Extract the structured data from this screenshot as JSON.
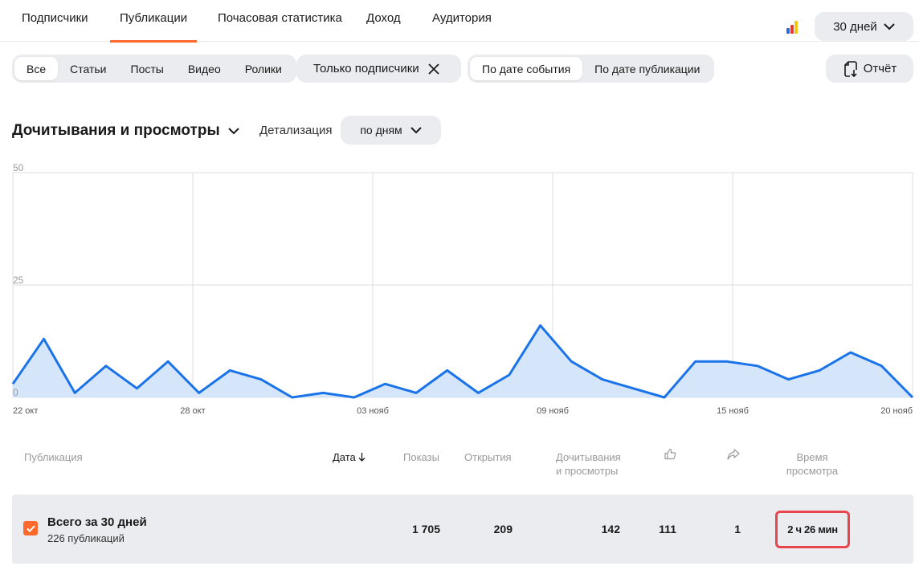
{
  "top_tabs": [
    {
      "label": "Подписчики",
      "active": false
    },
    {
      "label": "Публикации",
      "active": true
    },
    {
      "label": "Почасовая статистика",
      "active": false
    },
    {
      "label": "Доход",
      "active": false
    },
    {
      "label": "Аудитория",
      "active": false
    }
  ],
  "period": {
    "label": "30 дней",
    "icon": "chevron-down-icon"
  },
  "brand_colors": [
    "#2f6bd8",
    "#e63b2e",
    "#f5c518"
  ],
  "content_filter": {
    "items": [
      "Все",
      "Статьи",
      "Посты",
      "Видео",
      "Ролики"
    ],
    "selected": "Все"
  },
  "subscribers_filter": {
    "label": "Только подписчики",
    "icon": "close-icon"
  },
  "date_mode": {
    "items": [
      "По дате события",
      "По дате публикации"
    ],
    "selected": "По дате события"
  },
  "report_button": {
    "label": "Отчёт",
    "icon": "document-download-icon"
  },
  "chart_header": {
    "title": "Дочитывания и просмотры",
    "detail_label": "Детализация",
    "detail_value": "по дням"
  },
  "chart_data": {
    "type": "area",
    "ylim": [
      0,
      50
    ],
    "yticks": [
      "50",
      "25",
      "0"
    ],
    "xtick_labels": [
      "22 окт",
      "28 окт",
      "03 нояб",
      "09 нояб",
      "15 нояб",
      "20 нояб"
    ],
    "values": [
      3,
      13,
      1,
      7,
      2,
      8,
      1,
      6,
      4,
      0,
      1,
      0,
      3,
      1,
      6,
      1,
      5,
      16,
      8,
      4,
      2,
      0,
      8,
      8,
      7,
      4,
      6,
      10,
      7,
      0
    ],
    "line_color": "#1a73e8",
    "fill_color": "#d5e6fb",
    "grid": true
  },
  "table_header": {
    "publication": "Публикация",
    "date": "Дата",
    "shows": "Показы",
    "opens": "Открытия",
    "reads_line1": "Дочитывания",
    "reads_line2": "и просмотры",
    "likes_icon": "thumbs-up-icon",
    "shares_icon": "share-icon",
    "time_line1": "Время",
    "time_line2": "просмотра"
  },
  "summary": {
    "title": "Всего за 30 дней",
    "subtitle": "226 публикаций",
    "shows": "1 705",
    "opens": "209",
    "reads": "142",
    "likes": "111",
    "shares": "1",
    "time": "2 ч 26 мин"
  },
  "accent_color": "#ff6a2c",
  "highlight_color": "#e8454f"
}
